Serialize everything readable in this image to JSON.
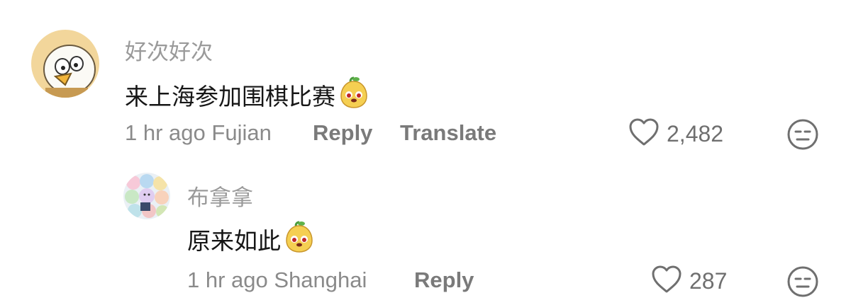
{
  "comments": [
    {
      "username": "好次好次",
      "text": "来上海参加围棋比赛",
      "time": "1 hr ago",
      "location": "Fujian",
      "reply_label": "Reply",
      "translate_label": "Translate",
      "likes": "2,482"
    },
    {
      "username": "布拿拿",
      "text": "原来如此",
      "time": "1 hr ago",
      "location": "Shanghai",
      "reply_label": "Reply",
      "likes": "287"
    }
  ],
  "icons": {
    "like": "heart-outline-icon",
    "dislike": "meh-face-icon",
    "emoji": "yellow-pear-face-emoji"
  },
  "colors": {
    "text": "#161616",
    "muted": "#9a9a9a",
    "icon": "#6f6f6f",
    "emoji": "#f5cf52"
  }
}
